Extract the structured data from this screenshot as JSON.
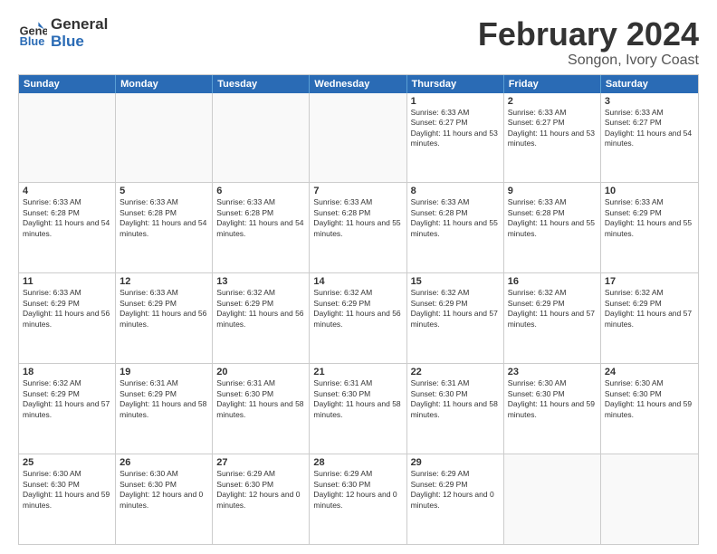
{
  "logo": {
    "line1": "General",
    "line2": "Blue"
  },
  "title": "February 2024",
  "subtitle": "Songon, Ivory Coast",
  "header": {
    "days": [
      "Sunday",
      "Monday",
      "Tuesday",
      "Wednesday",
      "Thursday",
      "Friday",
      "Saturday"
    ]
  },
  "rows": [
    {
      "cells": [
        {
          "empty": true
        },
        {
          "empty": true
        },
        {
          "empty": true
        },
        {
          "empty": true
        },
        {
          "day": "1",
          "sunrise": "6:33 AM",
          "sunset": "6:27 PM",
          "daylight": "11 hours and 53 minutes."
        },
        {
          "day": "2",
          "sunrise": "6:33 AM",
          "sunset": "6:27 PM",
          "daylight": "11 hours and 53 minutes."
        },
        {
          "day": "3",
          "sunrise": "6:33 AM",
          "sunset": "6:27 PM",
          "daylight": "11 hours and 54 minutes."
        }
      ]
    },
    {
      "cells": [
        {
          "day": "4",
          "sunrise": "6:33 AM",
          "sunset": "6:28 PM",
          "daylight": "11 hours and 54 minutes."
        },
        {
          "day": "5",
          "sunrise": "6:33 AM",
          "sunset": "6:28 PM",
          "daylight": "11 hours and 54 minutes."
        },
        {
          "day": "6",
          "sunrise": "6:33 AM",
          "sunset": "6:28 PM",
          "daylight": "11 hours and 54 minutes."
        },
        {
          "day": "7",
          "sunrise": "6:33 AM",
          "sunset": "6:28 PM",
          "daylight": "11 hours and 55 minutes."
        },
        {
          "day": "8",
          "sunrise": "6:33 AM",
          "sunset": "6:28 PM",
          "daylight": "11 hours and 55 minutes."
        },
        {
          "day": "9",
          "sunrise": "6:33 AM",
          "sunset": "6:28 PM",
          "daylight": "11 hours and 55 minutes."
        },
        {
          "day": "10",
          "sunrise": "6:33 AM",
          "sunset": "6:29 PM",
          "daylight": "11 hours and 55 minutes."
        }
      ]
    },
    {
      "cells": [
        {
          "day": "11",
          "sunrise": "6:33 AM",
          "sunset": "6:29 PM",
          "daylight": "11 hours and 56 minutes."
        },
        {
          "day": "12",
          "sunrise": "6:33 AM",
          "sunset": "6:29 PM",
          "daylight": "11 hours and 56 minutes."
        },
        {
          "day": "13",
          "sunrise": "6:32 AM",
          "sunset": "6:29 PM",
          "daylight": "11 hours and 56 minutes."
        },
        {
          "day": "14",
          "sunrise": "6:32 AM",
          "sunset": "6:29 PM",
          "daylight": "11 hours and 56 minutes."
        },
        {
          "day": "15",
          "sunrise": "6:32 AM",
          "sunset": "6:29 PM",
          "daylight": "11 hours and 57 minutes."
        },
        {
          "day": "16",
          "sunrise": "6:32 AM",
          "sunset": "6:29 PM",
          "daylight": "11 hours and 57 minutes."
        },
        {
          "day": "17",
          "sunrise": "6:32 AM",
          "sunset": "6:29 PM",
          "daylight": "11 hours and 57 minutes."
        }
      ]
    },
    {
      "cells": [
        {
          "day": "18",
          "sunrise": "6:32 AM",
          "sunset": "6:29 PM",
          "daylight": "11 hours and 57 minutes."
        },
        {
          "day": "19",
          "sunrise": "6:31 AM",
          "sunset": "6:29 PM",
          "daylight": "11 hours and 58 minutes."
        },
        {
          "day": "20",
          "sunrise": "6:31 AM",
          "sunset": "6:30 PM",
          "daylight": "11 hours and 58 minutes."
        },
        {
          "day": "21",
          "sunrise": "6:31 AM",
          "sunset": "6:30 PM",
          "daylight": "11 hours and 58 minutes."
        },
        {
          "day": "22",
          "sunrise": "6:31 AM",
          "sunset": "6:30 PM",
          "daylight": "11 hours and 58 minutes."
        },
        {
          "day": "23",
          "sunrise": "6:30 AM",
          "sunset": "6:30 PM",
          "daylight": "11 hours and 59 minutes."
        },
        {
          "day": "24",
          "sunrise": "6:30 AM",
          "sunset": "6:30 PM",
          "daylight": "11 hours and 59 minutes."
        }
      ]
    },
    {
      "cells": [
        {
          "day": "25",
          "sunrise": "6:30 AM",
          "sunset": "6:30 PM",
          "daylight": "11 hours and 59 minutes."
        },
        {
          "day": "26",
          "sunrise": "6:30 AM",
          "sunset": "6:30 PM",
          "daylight": "12 hours and 0 minutes."
        },
        {
          "day": "27",
          "sunrise": "6:29 AM",
          "sunset": "6:30 PM",
          "daylight": "12 hours and 0 minutes."
        },
        {
          "day": "28",
          "sunrise": "6:29 AM",
          "sunset": "6:30 PM",
          "daylight": "12 hours and 0 minutes."
        },
        {
          "day": "29",
          "sunrise": "6:29 AM",
          "sunset": "6:29 PM",
          "daylight": "12 hours and 0 minutes."
        },
        {
          "empty": true
        },
        {
          "empty": true
        }
      ]
    }
  ]
}
